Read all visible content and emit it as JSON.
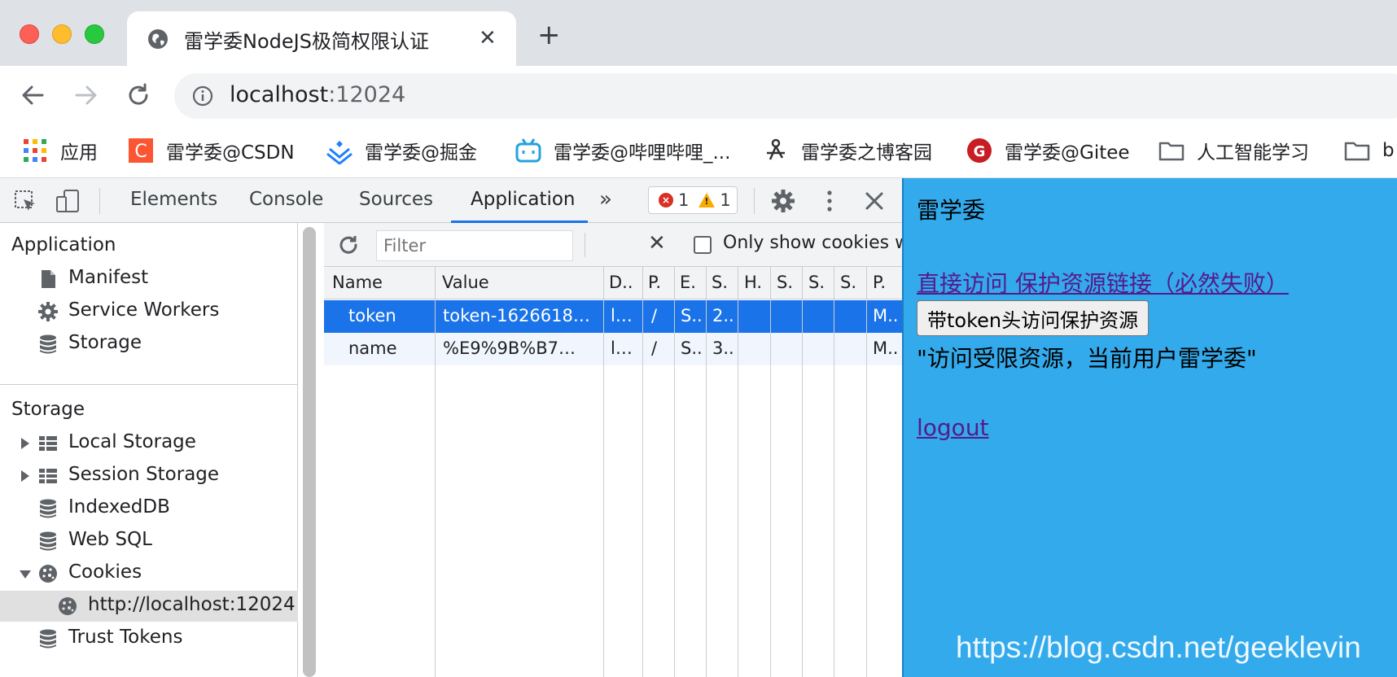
{
  "browser": {
    "tab_title": "雷学委NodeJS极简权限认证",
    "url_host": "localhost",
    "url_port": ":12024"
  },
  "bookmarks": [
    {
      "label": "应用",
      "icon": "apps-grid-icon"
    },
    {
      "label": "雷学委@CSDN",
      "icon": "csdn-icon"
    },
    {
      "label": "雷学委@掘金",
      "icon": "juejin-icon"
    },
    {
      "label": "雷学委@哔哩哔哩_...",
      "icon": "bilibili-icon"
    },
    {
      "label": "雷学委之博客园",
      "icon": "cnblogs-icon"
    },
    {
      "label": "雷学委@Gitee",
      "icon": "gitee-icon"
    },
    {
      "label": "人工智能学习",
      "icon": "folder-icon"
    },
    {
      "label": "b",
      "icon": "folder-icon"
    }
  ],
  "devtools": {
    "tabs": [
      "Elements",
      "Console",
      "Sources",
      "Application"
    ],
    "active_tab": "Application",
    "error_count": "1",
    "warning_count": "1"
  },
  "sidebar": {
    "application_heading": "Application",
    "application_items": [
      "Manifest",
      "Service Workers",
      "Storage"
    ],
    "storage_heading": "Storage",
    "storage_items": [
      "Local Storage",
      "Session Storage",
      "IndexedDB",
      "Web SQL",
      "Cookies",
      "http://localhost:12024",
      "Trust Tokens"
    ]
  },
  "cookies": {
    "filter_placeholder": "Filter",
    "only_show_label": "Only show cookies w",
    "columns": [
      "Name",
      "Value",
      "D..",
      "P.",
      "E.",
      "S.",
      "H.",
      "S.",
      "S.",
      "S.",
      "P."
    ],
    "rows": [
      [
        "token",
        "token-1626618…",
        "l…",
        "/",
        "S..",
        "2..",
        "",
        "",
        "",
        "",
        "M.."
      ],
      [
        "name",
        "%E9%9B%B7…",
        "l…",
        "/",
        "S..",
        "3..",
        "",
        "",
        "",
        "",
        "M.."
      ]
    ]
  },
  "page": {
    "title": "雷学委",
    "direct_link": "直接访问 保护资源链接（必然失败）",
    "token_button": "带token头访问保护资源",
    "message": "\"访问受限资源，当前用户雷学委\"",
    "logout": "logout",
    "watermark": "https://blog.csdn.net/geeklevin"
  }
}
